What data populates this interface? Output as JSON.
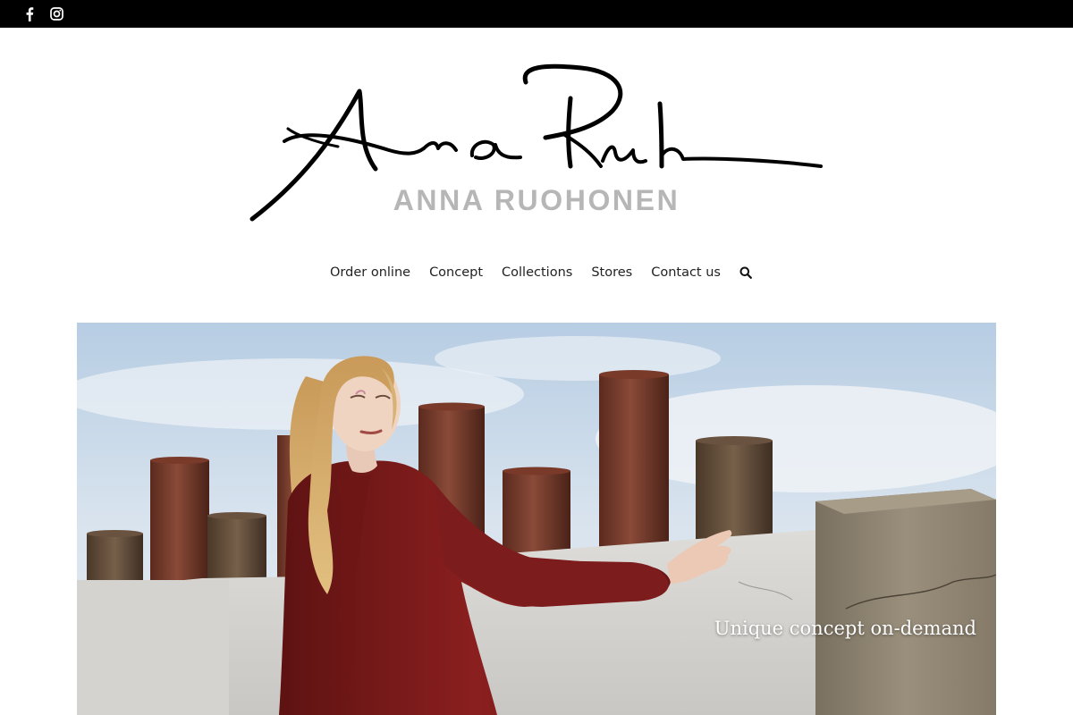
{
  "topbar": {
    "social": [
      {
        "name": "facebook",
        "icon": "facebook-icon"
      },
      {
        "name": "instagram",
        "icon": "instagram-icon"
      }
    ]
  },
  "logo": {
    "brand_text": "ANNA RUOHONEN",
    "signature": "Ana Ruh"
  },
  "nav": {
    "items": [
      "Order online",
      "Concept",
      "Collections",
      "Stores",
      "Contact us"
    ],
    "search_icon": "search-icon"
  },
  "hero": {
    "tagline": "Unique concept on-demand"
  },
  "colors": {
    "topbar": "#000000",
    "brand_text": "#b6b6b6",
    "nav_text": "#222222",
    "dress": "#7a1a1a"
  }
}
